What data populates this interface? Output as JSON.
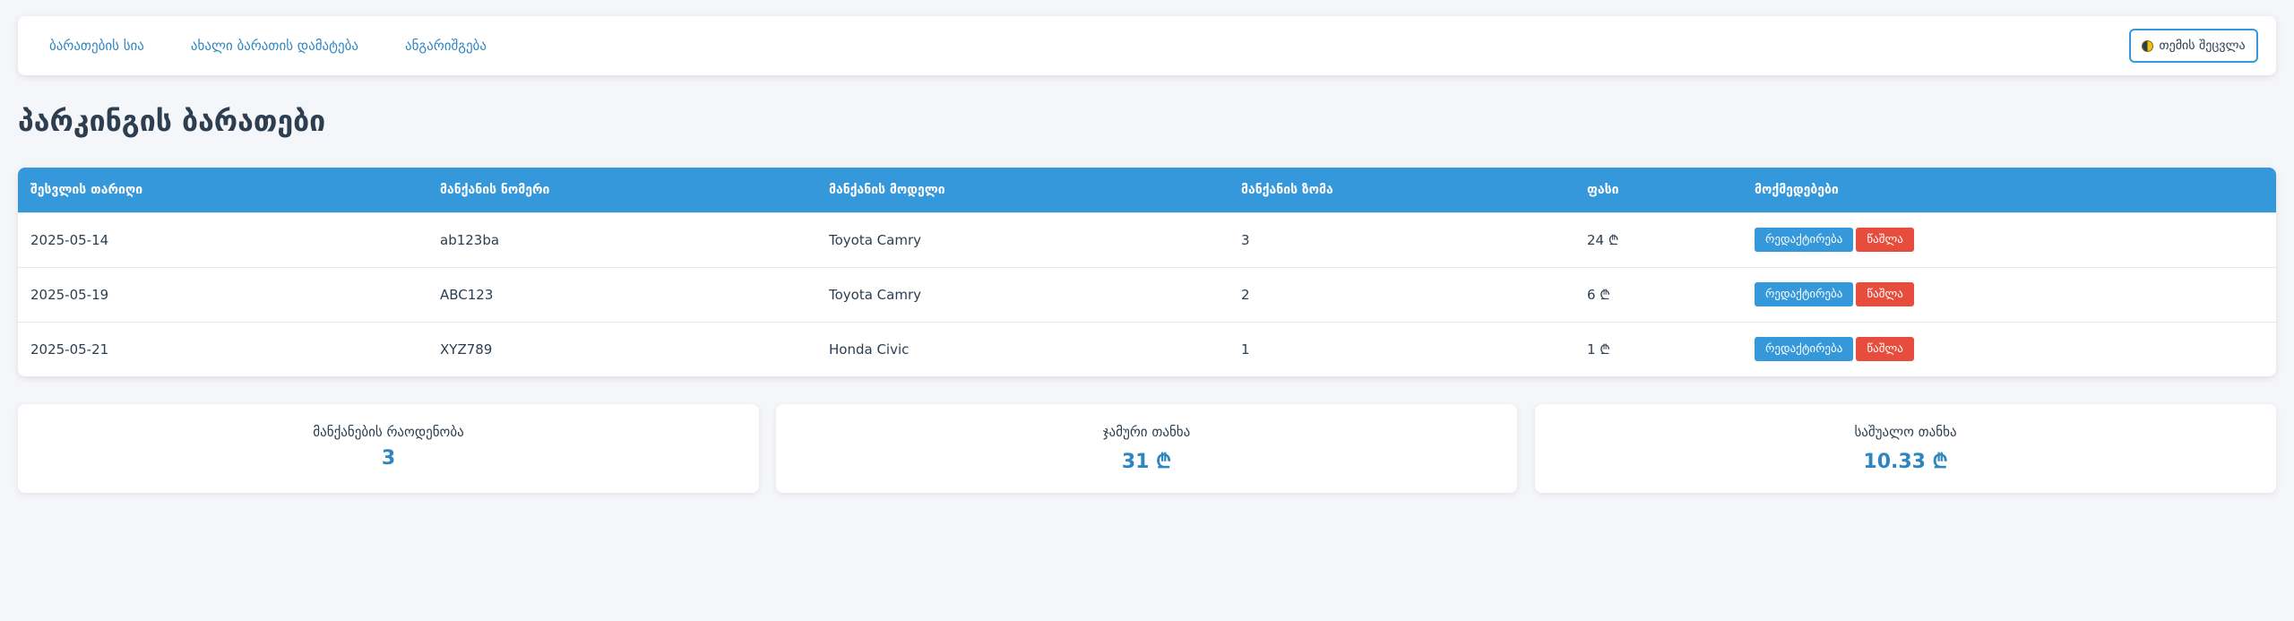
{
  "nav": {
    "links": [
      "ბარათების სია",
      "ახალი ბარათის დამატება",
      "ანგარიშგება"
    ],
    "theme_button": "თემის შეცვლა"
  },
  "page_title": "პარკინგის ბარათები",
  "table": {
    "headers": [
      "შესვლის თარიღი",
      "მანქანის ნომერი",
      "მანქანის მოდელი",
      "მანქანის ზომა",
      "ფასი",
      "მოქმედებები"
    ],
    "rows": [
      {
        "date": "2025-05-14",
        "plate": "ab123ba",
        "model": "Toyota Camry",
        "size": "3",
        "price": "24 ₾"
      },
      {
        "date": "2025-05-19",
        "plate": "ABC123",
        "model": "Toyota Camry",
        "size": "2",
        "price": "6 ₾"
      },
      {
        "date": "2025-05-21",
        "plate": "XYZ789",
        "model": "Honda Civic",
        "size": "1",
        "price": "1 ₾"
      }
    ],
    "edit_label": "რედაქტირება",
    "delete_label": "წაშლა"
  },
  "stats": [
    {
      "label": "მანქანების რაოდენობა",
      "value": "3"
    },
    {
      "label": "ჯამური თანხა",
      "value": "31 ₾"
    },
    {
      "label": "საშუალო თანხა",
      "value": "10.33 ₾"
    }
  ],
  "colors": {
    "accent": "#3498db",
    "danger": "#e74c3c",
    "background": "#f5f6fa",
    "text": "#2c3e50"
  },
  "icons": {
    "theme": "half-moon-icon"
  }
}
